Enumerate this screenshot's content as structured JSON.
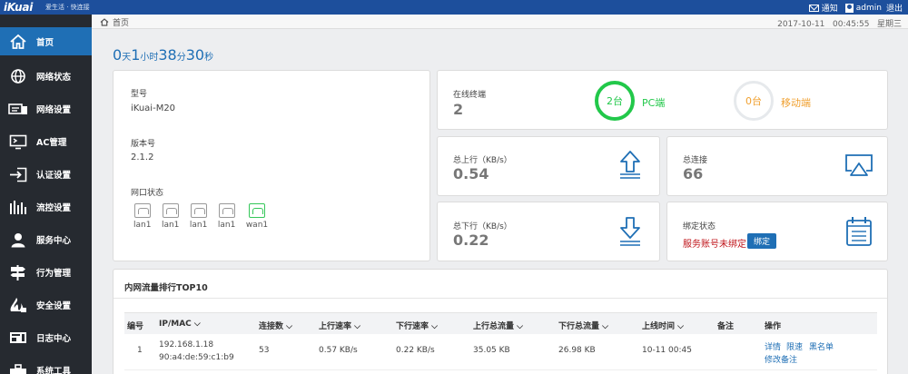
{
  "header": {
    "logo": "iKuai",
    "slogan": "爱生活 · 快连接",
    "notice_label": "通知",
    "user_label": "admin",
    "logout_label": "退出"
  },
  "sidebar": {
    "items": [
      {
        "label": "首页",
        "icon": "home-icon"
      },
      {
        "label": "网络状态",
        "icon": "globe-icon"
      },
      {
        "label": "网络设置",
        "icon": "network-settings-icon"
      },
      {
        "label": "AC管理",
        "icon": "monitor-icon"
      },
      {
        "label": "认证设置",
        "icon": "login-icon"
      },
      {
        "label": "流控设置",
        "icon": "bars-icon"
      },
      {
        "label": "服务中心",
        "icon": "user-service-icon"
      },
      {
        "label": "行为管理",
        "icon": "signpost-icon"
      },
      {
        "label": "安全设置",
        "icon": "fire-icon"
      },
      {
        "label": "日志中心",
        "icon": "log-icon"
      },
      {
        "label": "系统工具",
        "icon": "tools-icon"
      }
    ]
  },
  "breadcrumb": {
    "label": "首页",
    "datetime": "2017-10-11   00:45:55   星期三"
  },
  "uptime": {
    "d": "0",
    "d_u": "天",
    "h": "1",
    "h_u": "小时",
    "m": "38",
    "m_u": "分",
    "s": "30",
    "s_u": "秒"
  },
  "device": {
    "model_label": "型号",
    "model_value": "iKuai-M20",
    "version_label": "版本号",
    "version_value": "2.1.2",
    "ports_label": "网口状态",
    "ports": [
      {
        "name": "lan1",
        "status": "down"
      },
      {
        "name": "lan1",
        "status": "down"
      },
      {
        "name": "lan1",
        "status": "down"
      },
      {
        "name": "lan1",
        "status": "down"
      },
      {
        "name": "wan1",
        "status": "up"
      }
    ]
  },
  "online": {
    "label": "在线终端",
    "value": "2",
    "pc_count": "2台",
    "pc_label": "PC端",
    "mobile_count": "0台",
    "mobile_label": "移动端",
    "pc_color": "#22c84a",
    "mobile_color": "#f0a030"
  },
  "upload": {
    "label": "总上行（KB/s）",
    "value": "0.54",
    "icon": "upload-icon"
  },
  "connections": {
    "label": "总连接",
    "value": "66",
    "icon": "screencast-icon"
  },
  "download": {
    "label": "总下行（KB/s）",
    "value": "0.22",
    "icon": "download-icon"
  },
  "binding": {
    "label": "绑定状态",
    "status": "服务账号未绑定",
    "button": "绑定",
    "icon": "calendar-icon"
  },
  "traffic": {
    "title": "内网流量排行TOP10",
    "columns": [
      "编号",
      "IP/MAC",
      "连接数",
      "上行速率",
      "下行速率",
      "上行总流量",
      "下行总流量",
      "上线时间",
      "备注",
      "操作"
    ],
    "rows": [
      {
        "index": "1",
        "ip": "192.168.1.18",
        "mac": "90:a4:de:59:c1:b9",
        "connections": "53",
        "up_rate": "0.57 KB/s",
        "down_rate": "0.22 KB/s",
        "up_total": "35.05 KB",
        "down_total": "26.98 KB",
        "online_time": "10-11 00:45",
        "remark": "",
        "actions": [
          "详情",
          "限速",
          "黑名单",
          "修改备注"
        ]
      }
    ]
  }
}
